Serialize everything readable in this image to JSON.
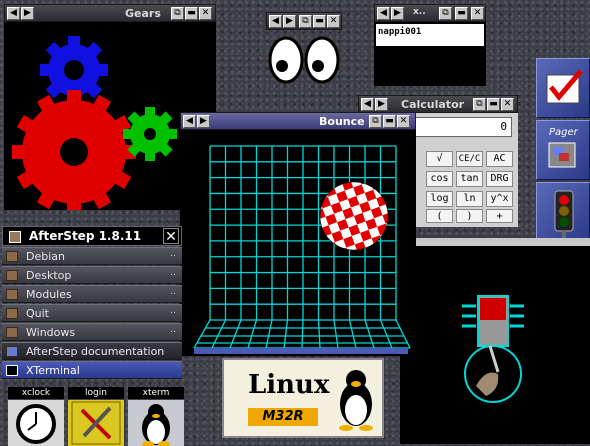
{
  "gears_window": {
    "title": "Gears"
  },
  "eyes_window": {},
  "xterm_small": {
    "title": "x..",
    "line": "nappi001"
  },
  "calculator": {
    "title": "Calculator",
    "display": "0",
    "keys": [
      "√",
      "CE/C",
      "AC",
      "cos",
      "tan",
      "DRG",
      "log",
      "ln",
      "y^x",
      "(",
      ")",
      "+"
    ]
  },
  "bounce": {
    "title": "Bounce"
  },
  "afterstep_menu": {
    "title": "AfterStep 1.8.11",
    "items": [
      {
        "label": "Debian"
      },
      {
        "label": "Desktop"
      },
      {
        "label": "Modules"
      },
      {
        "label": "Quit"
      },
      {
        "label": "Windows"
      }
    ],
    "docs_label": "AfterStep documentation",
    "xterminal_label": "XTerminal"
  },
  "wharf": {
    "items": [
      "xclock",
      "login",
      "xterm"
    ]
  },
  "linux_logo": {
    "line1": "Linux",
    "line2": "M32R"
  },
  "dock": {
    "pager_label": "Pager"
  },
  "colors": {
    "grid": "#00d8d8",
    "gear_blue": "#1010e0",
    "gear_red": "#e00000",
    "gear_green": "#00c000",
    "ball_red": "#e00000",
    "menu_highlight": "#3a4aa8"
  }
}
